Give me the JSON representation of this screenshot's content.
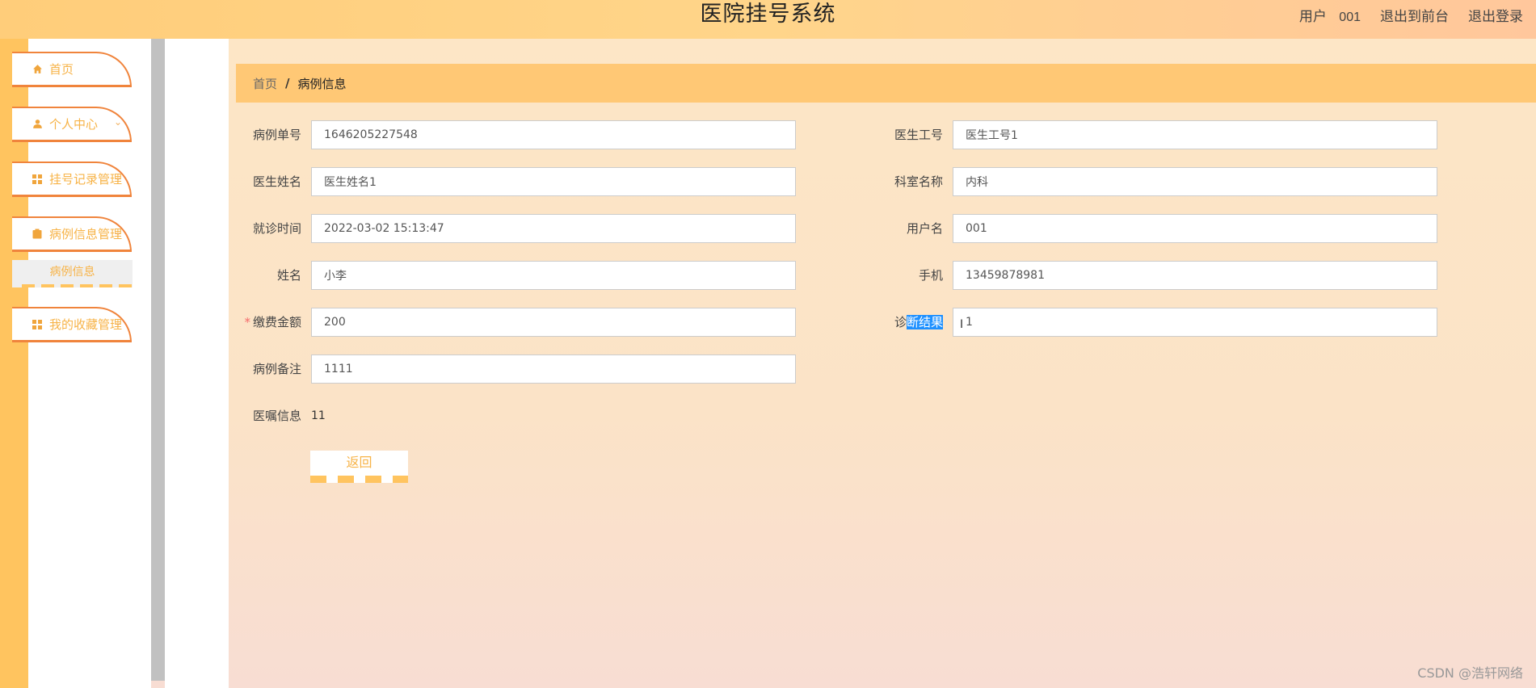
{
  "header": {
    "title": "医院挂号系统",
    "user_label": "用户",
    "user_value": "001",
    "back_front": "退出到前台",
    "logout": "退出登录"
  },
  "sidebar": {
    "items": [
      {
        "label": "首页",
        "icon": "home-icon"
      },
      {
        "label": "个人中心",
        "icon": "user-icon"
      },
      {
        "label": "挂号记录管理",
        "icon": "grid-icon"
      },
      {
        "label": "病例信息管理",
        "icon": "clipboard-icon"
      },
      {
        "label": "我的收藏管理",
        "icon": "grid-icon"
      }
    ],
    "sub_item": "病例信息"
  },
  "breadcrumb": {
    "home": "首页",
    "separator": "/",
    "current": "病例信息"
  },
  "form": {
    "case_no": {
      "label": "病例单号",
      "value": "1646205227548"
    },
    "doctor_id": {
      "label": "医生工号",
      "value": "医生工号1"
    },
    "doctor_name": {
      "label": "医生姓名",
      "value": "医生姓名1"
    },
    "dept_name": {
      "label": "科室名称",
      "value": "内科"
    },
    "visit_time": {
      "label": "就诊时间",
      "value": "2022-03-02 15:13:47"
    },
    "username": {
      "label": "用户名",
      "value": "001"
    },
    "name": {
      "label": "姓名",
      "value": "小李"
    },
    "phone": {
      "label": "手机",
      "value": "13459878981"
    },
    "fee": {
      "label": "缴费金额",
      "required_mark": "*",
      "value": "200"
    },
    "diagnosis": {
      "label_a": "诊",
      "label_b": "断结果",
      "value": "1"
    },
    "remark": {
      "label": "病例备注",
      "value": "1111"
    },
    "advice": {
      "label": "医嘱信息",
      "value": "11"
    },
    "back_button": "返回"
  },
  "watermark": "CSDN @浩轩网络",
  "colors": {
    "accent": "#ffc45f",
    "menu_border": "#f0843c",
    "menu_text": "#f7b347",
    "crumb_bg": "#ffc875"
  }
}
